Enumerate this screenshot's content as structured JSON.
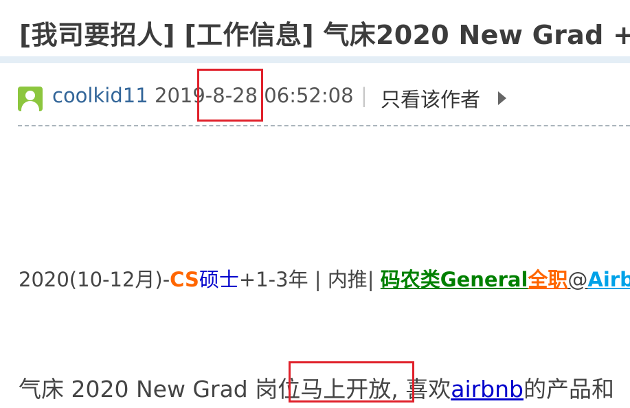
{
  "header": {
    "title": "[我司要招人] [工作信息] 气床2020 New Grad +"
  },
  "post": {
    "author": "coolkid11",
    "timestamp": "2019-8-28 06:52:08",
    "separator": "|",
    "only_author_label": "只看该作者"
  },
  "info_line": {
    "part1": "2020(10-12月)-",
    "cs": "CS",
    "masters": "硕士",
    "part2": "+1-3年 | 内推| ",
    "role_type": "码农类General",
    "fulltime": "全职",
    "at": "@",
    "company": "Airbn"
  },
  "body": {
    "text1": "气床 2020 New Grad 岗位马上开放, 喜欢",
    "link": "airbnb",
    "text2": "的产品和"
  },
  "colors": {
    "highlight": "#e0202a",
    "author_link": "#336699",
    "accent_orange": "#ff6600",
    "accent_green": "#008000"
  },
  "icons": [
    "avatar-placeholder-icon",
    "triangle-right-icon"
  ]
}
